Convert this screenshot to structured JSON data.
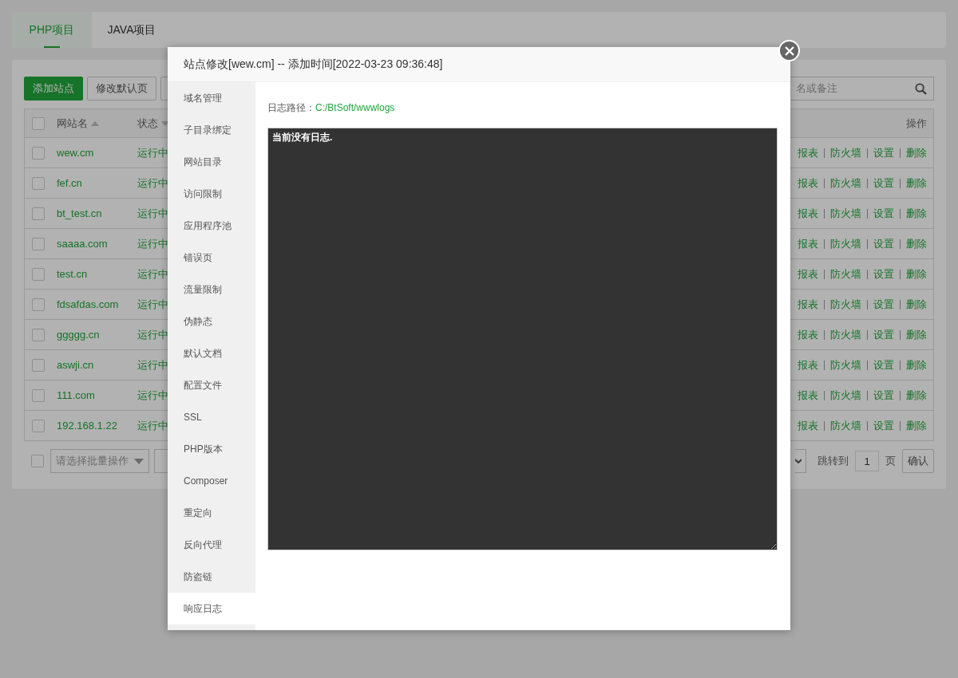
{
  "tabs": [
    {
      "label": "PHP项目",
      "selected": true
    },
    {
      "label": "JAVA项目",
      "selected": false
    }
  ],
  "toolbar": {
    "buttons": [
      {
        "label": "添加站点",
        "kind": "primary"
      },
      {
        "label": "修改默认页",
        "kind": "default"
      },
      {
        "kind": "default"
      }
    ],
    "search": {
      "placeholder": "名或备注"
    }
  },
  "table": {
    "select_all_checked": false,
    "columns": [
      {
        "label": "网站名",
        "kind": "sortup"
      },
      {
        "label": "状态",
        "kind": "sortdown"
      },
      {
        "label": "操作"
      }
    ],
    "rows": [
      {
        "name": "wew.cm",
        "status": "运行中",
        "checked": false,
        "actions": [
          "报表",
          "防火墙",
          "设置",
          "删除"
        ]
      },
      {
        "name": "fef.cn",
        "status": "运行中",
        "checked": false,
        "actions": [
          "报表",
          "防火墙",
          "设置",
          "删除"
        ]
      },
      {
        "name": "bt_test.cn",
        "status": "运行中",
        "checked": false,
        "actions": [
          "报表",
          "防火墙",
          "设置",
          "删除"
        ]
      },
      {
        "name": "saaaa.com",
        "status": "运行中",
        "checked": false,
        "actions": [
          "报表",
          "防火墙",
          "设置",
          "删除"
        ]
      },
      {
        "name": "test.cn",
        "status": "运行中",
        "checked": false,
        "actions": [
          "报表",
          "防火墙",
          "设置",
          "删除"
        ]
      },
      {
        "name": "fdsafdas.com",
        "status": "运行中",
        "checked": false,
        "actions": [
          "报表",
          "防火墙",
          "设置",
          "删除"
        ]
      },
      {
        "name": "ggggg.cn",
        "status": "运行中",
        "checked": false,
        "actions": [
          "报表",
          "防火墙",
          "设置",
          "删除"
        ]
      },
      {
        "name": "aswji.cn",
        "status": "运行中",
        "checked": false,
        "actions": [
          "报表",
          "防火墙",
          "设置",
          "删除"
        ]
      },
      {
        "name": "111.com",
        "status": "运行中",
        "checked": false,
        "actions": [
          "报表",
          "防火墙",
          "设置",
          "删除"
        ]
      },
      {
        "name": "192.168.1.22",
        "status": "运行中",
        "checked": false,
        "actions": [
          "报表",
          "防火墙",
          "设置",
          "删除"
        ]
      }
    ]
  },
  "footer": {
    "select_all_checked": false,
    "batch_placeholder": "请选择批量操作",
    "jump_label": "跳转到",
    "page": "1",
    "page_unit": "页",
    "confirm": "确认"
  },
  "modal": {
    "title": "站点修改[wew.cm] -- 添加时间[2022-03-23 09:36:48]",
    "nav": [
      {
        "label": "域名管理",
        "selected": false
      },
      {
        "label": "子目录绑定",
        "selected": false
      },
      {
        "label": "网站目录",
        "selected": false
      },
      {
        "label": "访问限制",
        "selected": false
      },
      {
        "label": "应用程序池",
        "selected": false
      },
      {
        "label": "错误页",
        "selected": false
      },
      {
        "label": "流量限制",
        "selected": false
      },
      {
        "label": "伪静态",
        "selected": false
      },
      {
        "label": "默认文档",
        "selected": false
      },
      {
        "label": "配置文件",
        "selected": false
      },
      {
        "label": "SSL",
        "selected": false
      },
      {
        "label": "PHP版本",
        "selected": false
      },
      {
        "label": "Composer",
        "selected": false
      },
      {
        "label": "重定向",
        "selected": false
      },
      {
        "label": "反向代理",
        "selected": false
      },
      {
        "label": "防盗链",
        "selected": false
      },
      {
        "label": "响应日志",
        "selected": true
      }
    ],
    "log_path_label": "日志路径：",
    "log_path": "C:/BtSoft/wwwlogs",
    "log_text": "当前没有日志."
  }
}
